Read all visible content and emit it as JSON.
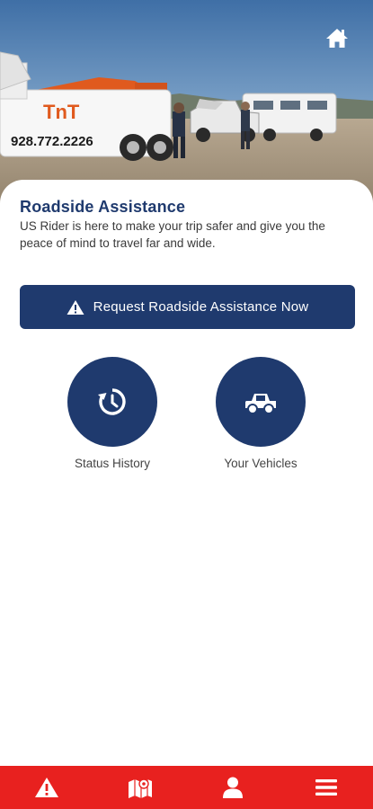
{
  "hero": {
    "truck_text_brand": "TnT",
    "truck_text_phone": "928.772.2226",
    "home_icon": "home-icon"
  },
  "content": {
    "title": "Roadside Assistance",
    "subtitle": "US Rider is here to make your trip safer and give you the peace of mind to travel far and wide."
  },
  "request_button": {
    "label": "Request Roadside Assistance Now",
    "icon": "warning-icon"
  },
  "actions": [
    {
      "label": "Status History",
      "icon": "history-icon"
    },
    {
      "label": "Your Vehicles",
      "icon": "truck-icon"
    }
  ],
  "bottom_nav": {
    "items": [
      {
        "icon": "warning-icon"
      },
      {
        "icon": "map-icon"
      },
      {
        "icon": "user-icon"
      },
      {
        "icon": "menu-icon"
      }
    ]
  },
  "colors": {
    "primary": "#1f3a6e",
    "accent": "#e8211f",
    "background": "#ffffff"
  }
}
